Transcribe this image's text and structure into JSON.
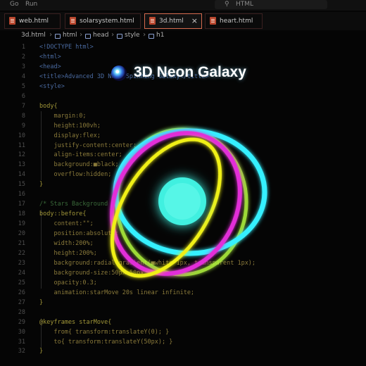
{
  "menu": {
    "items": [
      "Go",
      "Run"
    ],
    "search_icon": "search-icon",
    "search_text": "HTML"
  },
  "tabs": [
    {
      "label": "web.html",
      "active": false
    },
    {
      "label": "solarsystem.html",
      "active": false
    },
    {
      "label": "3d.html",
      "active": true,
      "close": "×"
    },
    {
      "label": "heart.html",
      "active": false
    }
  ],
  "breadcrumb": {
    "items": [
      "3d.html",
      "html",
      "head",
      "style",
      "h1"
    ],
    "separator": "›"
  },
  "editor": {
    "lines": [
      {
        "n": "1",
        "code": "<!DOCTYPE html>",
        "cls": "c-tag"
      },
      {
        "n": "2",
        "code": "<html>",
        "cls": "c-tag"
      },
      {
        "n": "3",
        "code": "<head>",
        "cls": "c-tag"
      },
      {
        "n": "4",
        "code": "<title>Advanced 3D Neon Spinning Galaxy</title>",
        "cls": "c-tag"
      },
      {
        "n": "5",
        "code": "<style>",
        "cls": "c-tag"
      },
      {
        "n": "6",
        "code": "",
        "cls": "c-sel"
      },
      {
        "n": "7",
        "code": "body{",
        "cls": "c-sel"
      },
      {
        "n": "8",
        "code": "    margin:0;",
        "cls": "c-val"
      },
      {
        "n": "9",
        "code": "    height:100vh;",
        "cls": "c-val"
      },
      {
        "n": "10",
        "code": "    display:flex;",
        "cls": "c-val"
      },
      {
        "n": "11",
        "code": "    justify-content:center;",
        "cls": "c-val"
      },
      {
        "n": "12",
        "code": "    align-items:center;",
        "cls": "c-val"
      },
      {
        "n": "13",
        "code": "    background:■black;",
        "cls": "c-val"
      },
      {
        "n": "14",
        "code": "    overflow:hidden;",
        "cls": "c-val"
      },
      {
        "n": "15",
        "code": "}",
        "cls": "c-sel"
      },
      {
        "n": "16",
        "code": "",
        "cls": "c-sel"
      },
      {
        "n": "17",
        "code": "/* Stars Background */",
        "cls": "c-com"
      },
      {
        "n": "18",
        "code": "body::before{",
        "cls": "c-sel"
      },
      {
        "n": "19",
        "code": "    content:\"\";",
        "cls": "c-val"
      },
      {
        "n": "20",
        "code": "    position:absolute;",
        "cls": "c-val"
      },
      {
        "n": "21",
        "code": "    width:200%;",
        "cls": "c-val"
      },
      {
        "n": "22",
        "code": "    height:200%;",
        "cls": "c-val"
      },
      {
        "n": "23",
        "code": "    background:radial-gradient(■white 1px, transparent 1px);",
        "cls": "c-val"
      },
      {
        "n": "24",
        "code": "    background-size:50px 50px;",
        "cls": "c-val"
      },
      {
        "n": "25",
        "code": "    opacity:0.3;",
        "cls": "c-val"
      },
      {
        "n": "26",
        "code": "    animation:starMove 20s linear infinite;",
        "cls": "c-val"
      },
      {
        "n": "27",
        "code": "}",
        "cls": "c-sel"
      },
      {
        "n": "28",
        "code": "",
        "cls": "c-sel"
      },
      {
        "n": "29",
        "code": "@keyframes starMove{",
        "cls": "c-sel"
      },
      {
        "n": "30",
        "code": "    from{ transform:translateY(0); }",
        "cls": "c-val"
      },
      {
        "n": "31",
        "code": "    to{ transform:translateY(50px); }",
        "cls": "c-val"
      },
      {
        "n": "32",
        "code": "}",
        "cls": "c-sel"
      }
    ]
  },
  "preview": {
    "title_icon": "galaxy-icon",
    "title": "3D Neon Galaxy",
    "colors": {
      "core": "#3ff0e0",
      "ring_cyan": "#36f0ff",
      "ring_magenta": "#e22fd8",
      "ring_yellow": "#f0f018",
      "ring_lime": "#b8ff40"
    }
  }
}
